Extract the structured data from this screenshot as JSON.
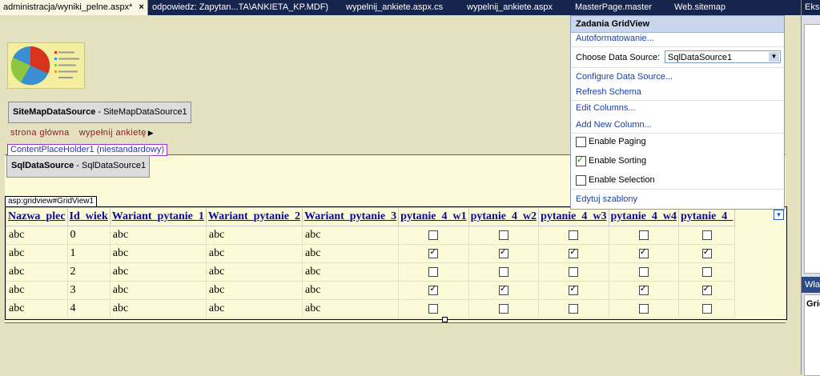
{
  "tabs": [
    {
      "label": "administracja/wyniki_pelne.aspx*",
      "active": true
    },
    {
      "label": "odpowiedz: Zapytan...TA\\ANKIETA_KP.MDF)",
      "active": false
    },
    {
      "label": "wypelnij_ankiete.aspx.cs",
      "active": false
    },
    {
      "label": "wypelnij_ankiete.aspx",
      "active": false
    },
    {
      "label": "MasterPage.master",
      "active": false
    },
    {
      "label": "Web.sitemap",
      "active": false
    }
  ],
  "tab_close_glyph": "×",
  "right_panel": {
    "header": "Eksp",
    "lower_header": "Właś",
    "grid_label": "Grid"
  },
  "sitemap_control": {
    "name": "SiteMapDataSource",
    "id": " - SiteMapDataSource1"
  },
  "breadcrumb": {
    "items": [
      "strona główna",
      "wypełnij ankietę"
    ],
    "arrow": "▶"
  },
  "content_placeholder_label": "ContentPlaceHolder1 (niestandardowy)",
  "sql_control": {
    "name": "SqlDataSource",
    "id": " - SqlDataSource1"
  },
  "gridview_label": "asp:gridview#GridView1",
  "grid": {
    "headers": [
      "Nazwa_plec",
      "Id_wiek",
      "Wariant_pytanie_1",
      "Wariant_pytanie_2",
      "Wariant_pytanie_3",
      "pytanie_4_w1",
      "pytanie_4_w2",
      "pytanie_4_w3",
      "pytanie_4_w4",
      "pytanie_4_"
    ],
    "rows": [
      {
        "c": [
          "abc",
          "0",
          "abc",
          "abc",
          "abc"
        ],
        "checks": [
          false,
          false,
          false,
          false,
          false
        ]
      },
      {
        "c": [
          "abc",
          "1",
          "abc",
          "abc",
          "abc"
        ],
        "checks": [
          true,
          true,
          true,
          true,
          true
        ]
      },
      {
        "c": [
          "abc",
          "2",
          "abc",
          "abc",
          "abc"
        ],
        "checks": [
          false,
          false,
          false,
          false,
          false
        ]
      },
      {
        "c": [
          "abc",
          "3",
          "abc",
          "abc",
          "abc"
        ],
        "checks": [
          true,
          true,
          true,
          true,
          true
        ]
      },
      {
        "c": [
          "abc",
          "4",
          "abc",
          "abc",
          "abc"
        ],
        "checks": [
          false,
          false,
          false,
          false,
          false
        ]
      }
    ]
  },
  "tasks_panel": {
    "title": "Zadania GridView",
    "autoformat": "Autoformatowanie...",
    "choose_ds_label": "Choose Data Source:",
    "choose_ds_value": "SqlDataSource1",
    "configure": "Configure Data Source...",
    "refresh": "Refresh Schema",
    "edit_columns": "Edit Columns...",
    "add_column": "Add New Column...",
    "enable_paging": {
      "label": "Enable Paging",
      "checked": false
    },
    "enable_sorting": {
      "label": "Enable Sorting",
      "checked": true
    },
    "enable_selection": {
      "label": "Enable Selection",
      "checked": false
    },
    "edit_templates": "Edytuj szablony"
  },
  "colors": {
    "tabbar": "#15254d",
    "surface": "#e3e1be",
    "grid_bg": "#fbfbd8",
    "link": "#1a3fa8",
    "header_link": "#0a0aa0"
  }
}
